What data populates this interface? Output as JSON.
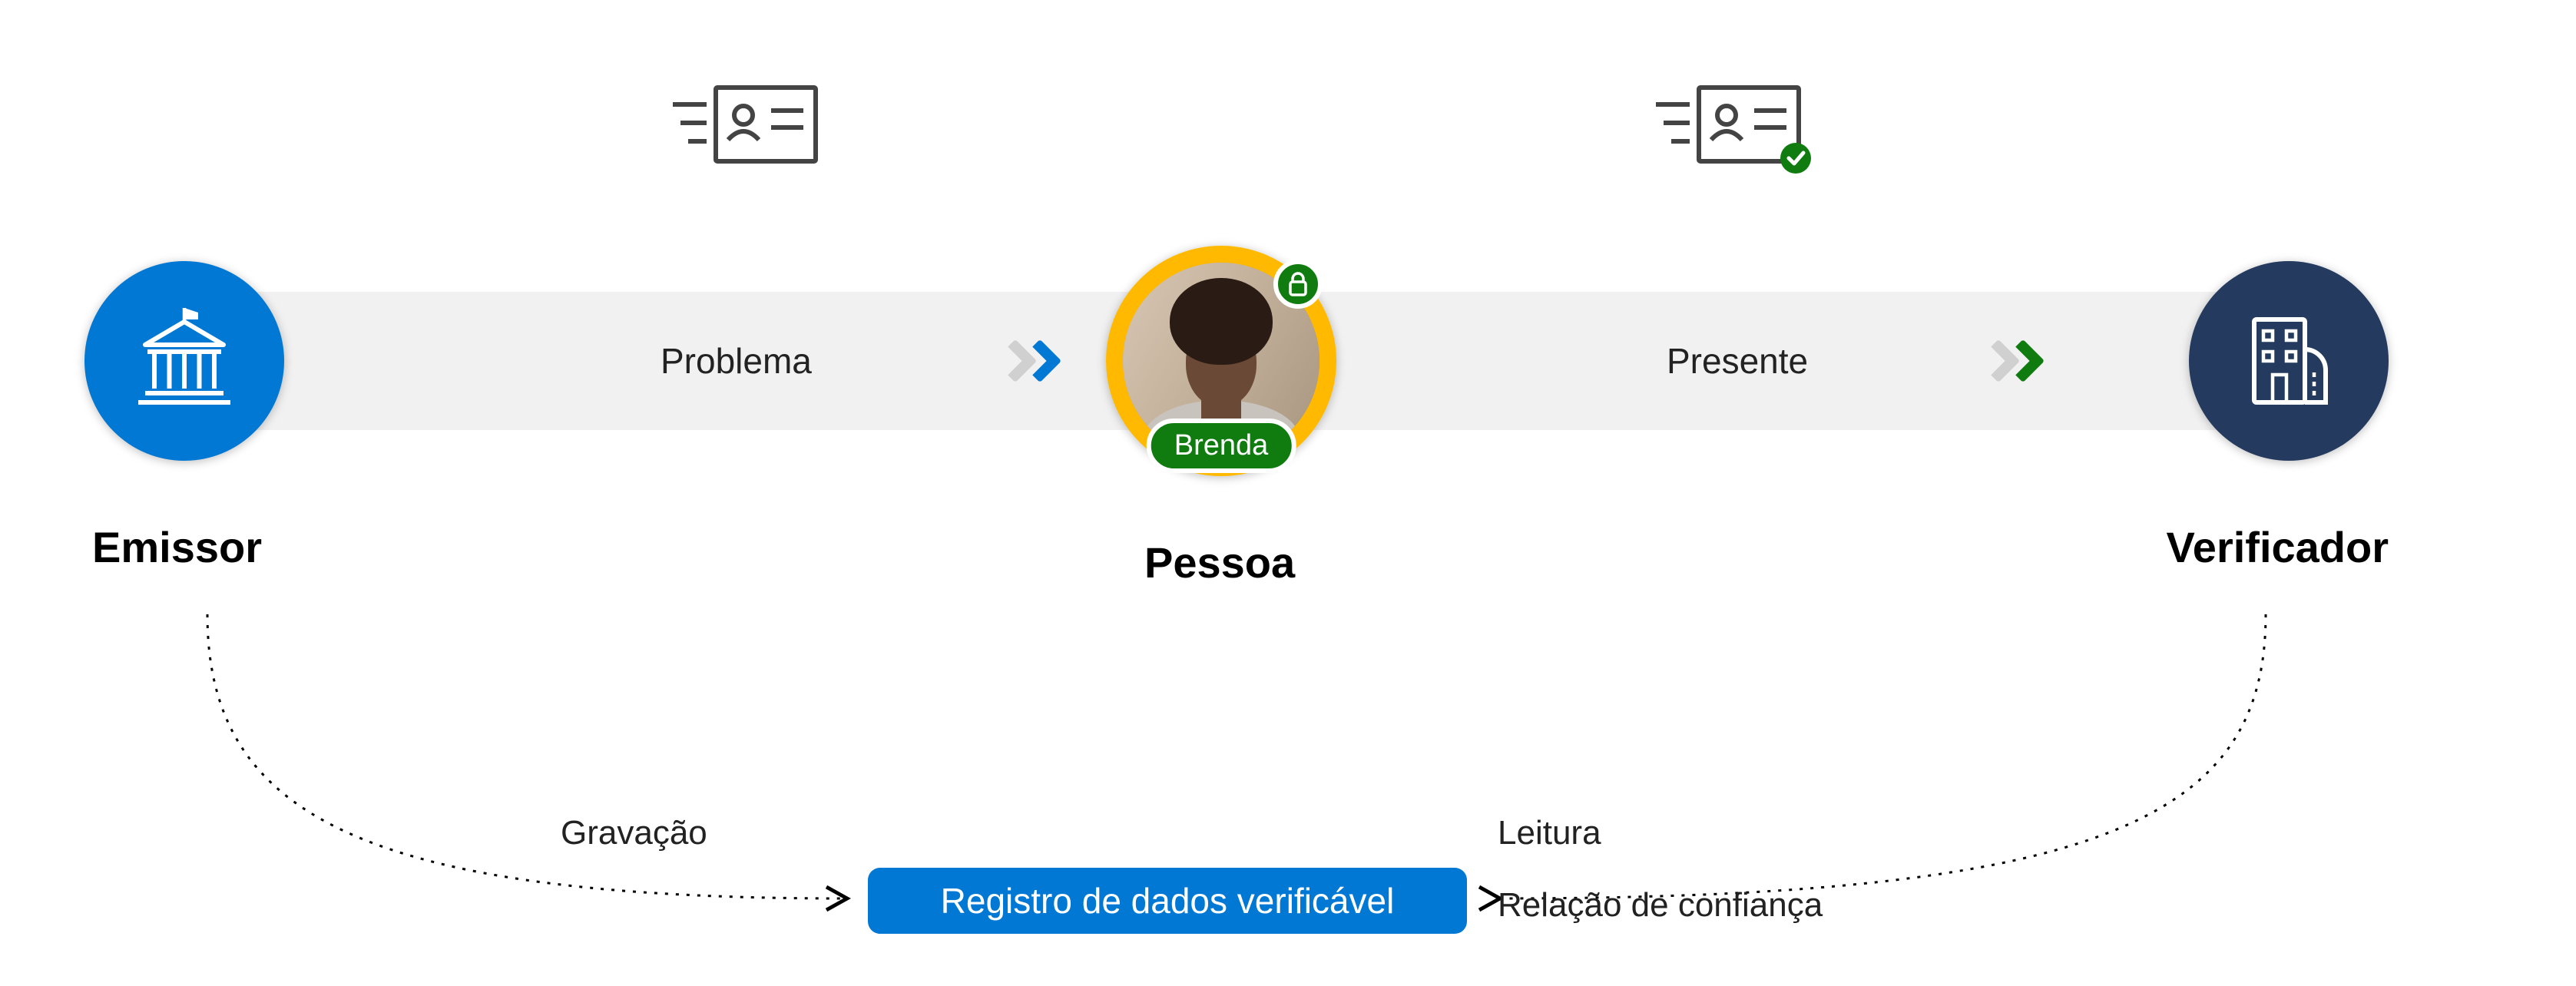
{
  "nodes": {
    "issuer": {
      "title": "Emissor"
    },
    "person": {
      "title": "Pessoa",
      "name_badge": "Brenda"
    },
    "verifier": {
      "title": "Verificador"
    }
  },
  "flow": {
    "issue_label": "Problema",
    "present_label": "Presente"
  },
  "arcs": {
    "write_label": "Gravação",
    "read_label": "Leitura",
    "trust_label": "Relação de confiança"
  },
  "registry": {
    "label": "Registro de dados verificável"
  },
  "colors": {
    "blue": "#0078d4",
    "green": "#107c10",
    "navy": "#243a5e",
    "amber": "#ffb900",
    "gray_bar": "#f1f1f1"
  }
}
